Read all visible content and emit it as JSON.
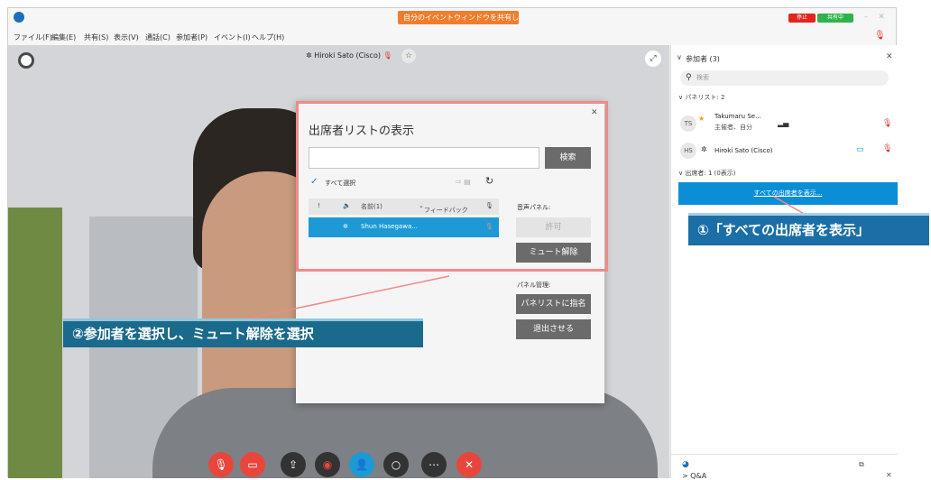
{
  "window": {
    "share_banner": "自分のイベントウィンドウを共有し...",
    "status_stop": "停止",
    "status_sharing": "共有中"
  },
  "menu": {
    "items": [
      "ファイル(F)",
      "編集(E)",
      "共有(S)",
      "表示(V)",
      "通話(C)",
      "参加者(P)",
      "イベント(I)",
      "ヘルプ(H)"
    ]
  },
  "video": {
    "speaker_name": "Hiroki Sato (Cisco)"
  },
  "dialog": {
    "title": "出席者リストの表示",
    "search_value": "",
    "search_button": "検索",
    "select_all": "すべて選択",
    "columns": {
      "exclaim": "!",
      "name": "名前(1)",
      "feedback": "フィードバック"
    },
    "rows": [
      {
        "name": "Shun Hasegawa..."
      }
    ],
    "audio_panel_label": "音声パネル:",
    "allow_button": "許可",
    "unmute_button": "ミュート解除",
    "panel_manage_label": "パネル管理:",
    "make_panelist_button": "パネリストに指名",
    "expel_button": "退出させる"
  },
  "participants": {
    "title": "参加者 (3)",
    "search_placeholder": "検索",
    "panelists_label": "パネリスト: 2",
    "panelists": [
      {
        "initials": "TS",
        "name": "Takumaru Se...",
        "role": "主催者、自分"
      },
      {
        "initials": "HS",
        "name": "Hiroki Sato (Cisco)",
        "role": ""
      }
    ],
    "attendees_label": "出席者: 1 (0表示)",
    "show_all_link": "すべての出席者を表示...",
    "qa_label": "Q&A"
  },
  "callouts": {
    "step1": "①「すべての出席者を表示」",
    "step2": "②参加者を選択し、ミュート解除を選択"
  },
  "colors": {
    "accent_blue": "#0a8ed6",
    "mute_red": "#e0312a",
    "banner_orange": "#ef7d2e"
  }
}
